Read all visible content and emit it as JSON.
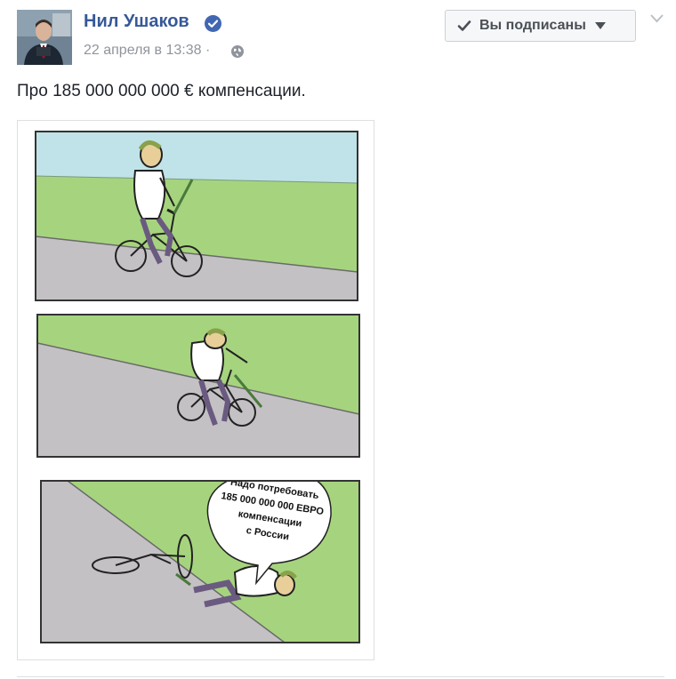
{
  "post": {
    "author": "Нил Ушаков",
    "date": "22 апреля в 13:38",
    "separator": "·",
    "privacy_icon": "globe-icon",
    "verified_icon": "verified-badge-icon",
    "follow_button": "Вы подписаны",
    "text": "Про 185 000 000 000 € компенсации.",
    "colors": {
      "author_link": "#365899",
      "verified": "#4267b2",
      "sky": "#bfe3e8",
      "grass": "#a6d47e",
      "road": "#c4c1c4"
    }
  },
  "meme": {
    "speech_bubble": [
      "Надо потребовать",
      "185 000 000 000 ЕВРО",
      "компенсации",
      "с России"
    ]
  }
}
